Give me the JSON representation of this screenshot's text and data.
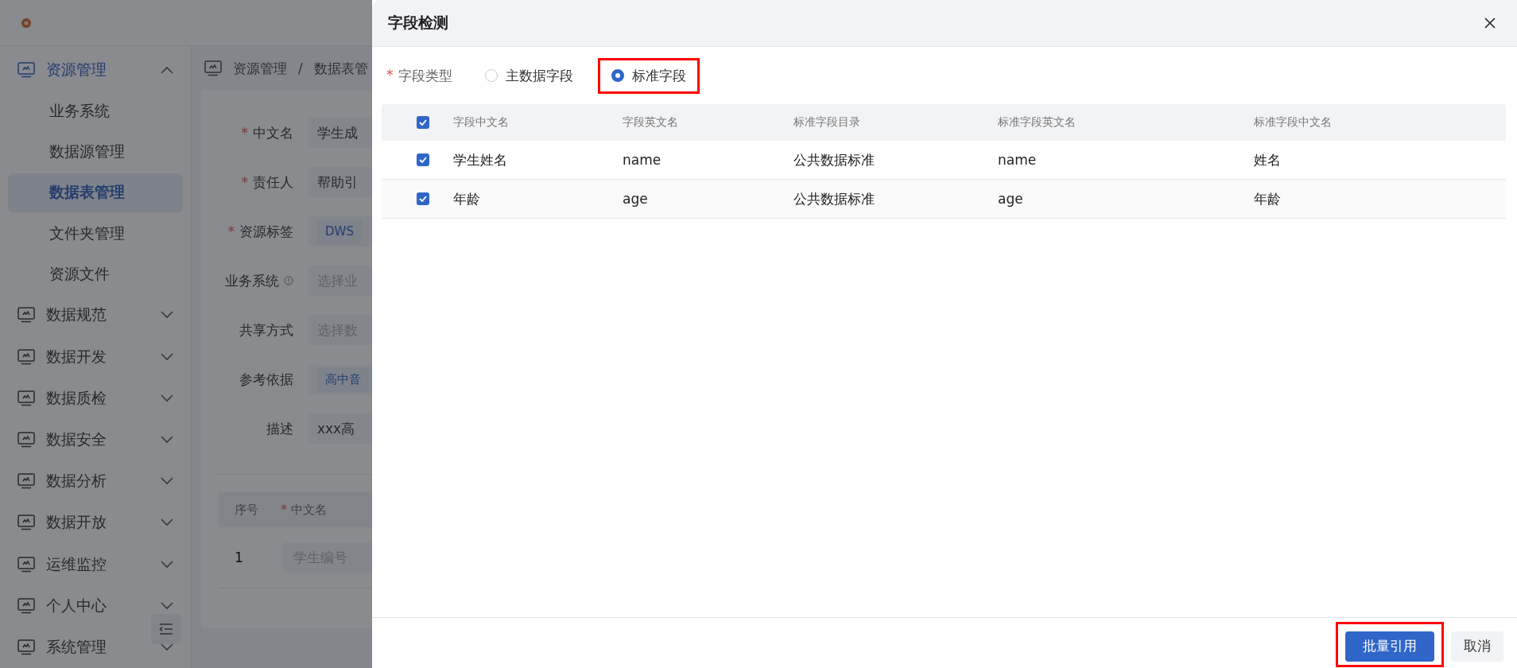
{
  "page": {
    "sidebar": {
      "items": [
        {
          "label": "资源管理",
          "selected": true,
          "expanded": true,
          "children": [
            {
              "label": "业务系统",
              "selected": false
            },
            {
              "label": "数据源管理",
              "selected": false
            },
            {
              "label": "数据表管理",
              "selected": true
            },
            {
              "label": "文件夹管理",
              "selected": false
            },
            {
              "label": "资源文件",
              "selected": false
            }
          ]
        },
        {
          "label": "数据规范",
          "selected": false,
          "expanded": false
        },
        {
          "label": "数据开发",
          "selected": false,
          "expanded": false
        },
        {
          "label": "数据质检",
          "selected": false,
          "expanded": false
        },
        {
          "label": "数据安全",
          "selected": false,
          "expanded": false
        },
        {
          "label": "数据分析",
          "selected": false,
          "expanded": false
        },
        {
          "label": "数据开放",
          "selected": false,
          "expanded": false
        },
        {
          "label": "运维监控",
          "selected": false,
          "expanded": false
        },
        {
          "label": "个人中心",
          "selected": false,
          "expanded": false
        },
        {
          "label": "系统管理",
          "selected": false,
          "expanded": false
        }
      ]
    },
    "breadcrumb": {
      "separator": "/",
      "items": [
        "资源管理",
        "数据表管"
      ]
    },
    "form": [
      {
        "mark": "*",
        "label": "中文名",
        "info": false,
        "kind": "value",
        "text": "学生成"
      },
      {
        "mark": "*",
        "label": "责任人",
        "info": false,
        "kind": "value",
        "text": "帮助引"
      },
      {
        "mark": "*",
        "label": "资源标签",
        "info": false,
        "kind": "tag",
        "text": "DWS"
      },
      {
        "label": "业务系统",
        "info": true,
        "kind": "placeholder",
        "text": "选择业"
      },
      {
        "label": "共享方式",
        "info": false,
        "kind": "placeholder",
        "text": "选择数"
      },
      {
        "label": "参考依据",
        "info": false,
        "kind": "tag",
        "text": "高中音"
      },
      {
        "label": "描述",
        "info": false,
        "kind": "value",
        "text": "xxx高"
      }
    ],
    "fields_table": {
      "columns": [
        {
          "label": "序号"
        },
        {
          "mark": "*",
          "label": "中文名"
        }
      ],
      "rows": [
        {
          "index": "1",
          "placeholder": "学生编号"
        }
      ]
    }
  },
  "dialog": {
    "title": "字段检测",
    "field_type": {
      "mark": "*",
      "label": "字段类型",
      "options": [
        {
          "label": "主数据字段",
          "selected": false,
          "highlighted": false
        },
        {
          "label": "标准字段",
          "selected": true,
          "highlighted": true
        }
      ]
    },
    "table": {
      "all_checked": true,
      "columns": [
        "字段中文名",
        "字段英文名",
        "标准字段目录",
        "标准字段英文名",
        "标准字段中文名"
      ],
      "rows": [
        {
          "checked": true,
          "cells": [
            "学生姓名",
            "name",
            "公共数据标准",
            "name",
            "姓名"
          ]
        },
        {
          "checked": true,
          "cells": [
            "年龄",
            "age",
            "公共数据标准",
            "age",
            "年龄"
          ]
        }
      ]
    },
    "buttons": [
      {
        "label": "批量引用",
        "kind": "primary",
        "highlighted": true
      },
      {
        "label": "取消",
        "kind": "default",
        "highlighted": false
      }
    ]
  }
}
